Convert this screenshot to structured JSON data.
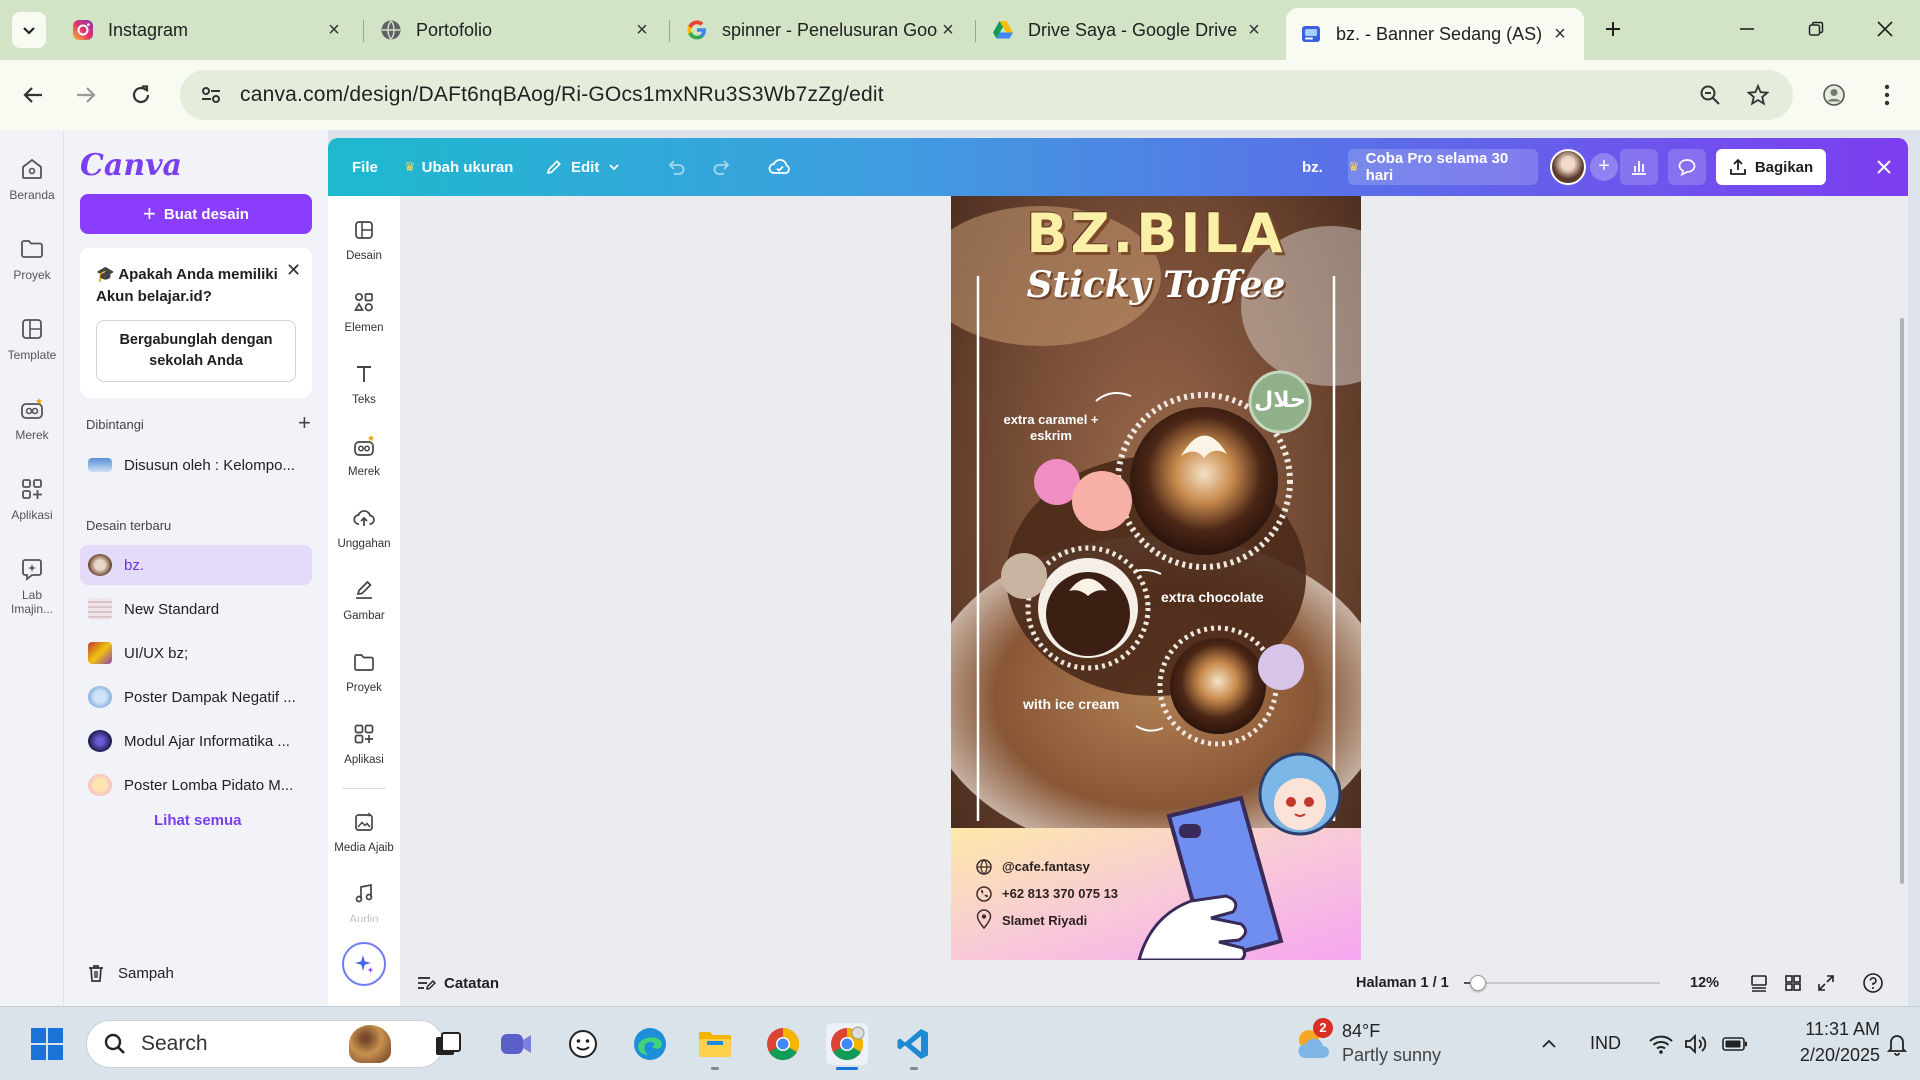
{
  "browser": {
    "tabs": [
      {
        "title": "Instagram",
        "favicon": "instagram-icon"
      },
      {
        "title": "Portofolio",
        "favicon": "globe-icon"
      },
      {
        "title": "spinner - Penelusuran Google",
        "favicon": "google-icon"
      },
      {
        "title": "Drive Saya - Google Drive",
        "favicon": "google-drive-icon"
      },
      {
        "title": "bz. - Banner Sedang (AS)",
        "favicon": "canva-icon",
        "active": true
      }
    ],
    "url": "canva.com/design/DAFt6nqBAog/Ri-GOcs1mxNRu3S3Wb7zZg/edit"
  },
  "rail": {
    "items": [
      {
        "label": "Beranda",
        "icon": "home-icon"
      },
      {
        "label": "Proyek",
        "icon": "folder-icon"
      },
      {
        "label": "Template",
        "icon": "template-icon"
      },
      {
        "label": "Merek",
        "icon": "brand-icon"
      },
      {
        "label": "Aplikasi",
        "icon": "apps-icon"
      },
      {
        "label": "Lab Imajin...",
        "icon": "lab-icon"
      }
    ]
  },
  "panel": {
    "logo": "Canva",
    "create_button": "Buat desain",
    "promo_text": "Apakah Anda memiliki Akun belajar.id?",
    "promo_button": "Bergabunglah dengan sekolah Anda",
    "starred_title": "Dibintangi",
    "starred_items": [
      "Disusun oleh : Kelompo..."
    ],
    "recent_title": "Desain terbaru",
    "recent_items": [
      "bz.",
      "New Standard",
      "UI/UX bz;",
      "Poster Dampak Negatif ...",
      "Modul Ajar Informatika ...",
      "Poster Lomba Pidato M..."
    ],
    "see_all": "Lihat semua",
    "trash": "Sampah"
  },
  "header": {
    "file": "File",
    "resize": "Ubah ukuran",
    "edit": "Edit",
    "doc_title": "bz.",
    "try_pro": "Coba Pro selama 30 hari",
    "share": "Bagikan"
  },
  "tools": [
    {
      "label": "Desain",
      "icon": "design-icon"
    },
    {
      "label": "Elemen",
      "icon": "elements-icon"
    },
    {
      "label": "Teks",
      "icon": "text-icon"
    },
    {
      "label": "Merek",
      "icon": "brand-icon"
    },
    {
      "label": "Unggahan",
      "icon": "upload-icon"
    },
    {
      "label": "Gambar",
      "icon": "draw-icon"
    },
    {
      "label": "Proyek",
      "icon": "folder-icon"
    },
    {
      "label": "Aplikasi",
      "icon": "apps-icon"
    },
    {
      "label": "Media Ajaib",
      "icon": "magic-media-icon"
    },
    {
      "label": "Audio",
      "icon": "audio-icon"
    }
  ],
  "poster": {
    "title": "BZ.BILA",
    "subtitle": "Sticky Toffee",
    "label_caramel": "extra caramel + eskrim",
    "label_chocolate": "extra chocolate",
    "label_icecream": "with ice cream",
    "halal_text": "حلال",
    "contact_instagram": "@cafe.fantasy",
    "contact_phone": "+62 813 370 075 13",
    "contact_address": "Slamet Riyadi"
  },
  "bottom": {
    "notes": "Catatan",
    "page": "Halaman 1 / 1",
    "zoom": "12%",
    "zoom_level": 0.07
  },
  "taskbar": {
    "search_placeholder": "Search",
    "weather_temp": "84°F",
    "weather_desc": "Partly sunny",
    "weather_badge": "2",
    "language": "IND",
    "time": "11:31 AM",
    "date": "2/20/2025"
  }
}
